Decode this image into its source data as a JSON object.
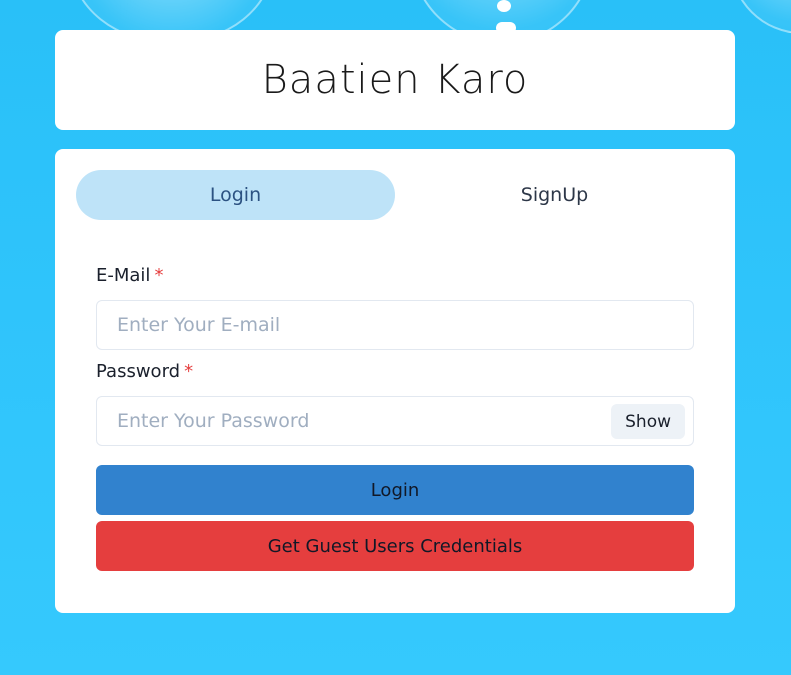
{
  "app": {
    "title": "Baatien Karo"
  },
  "tabs": [
    {
      "label": "Login",
      "active": true
    },
    {
      "label": "SignUp",
      "active": false
    }
  ],
  "form": {
    "email": {
      "label": "E-Mail",
      "required_mark": "*",
      "placeholder": "Enter Your E-mail",
      "value": ""
    },
    "password": {
      "label": "Password",
      "required_mark": "*",
      "placeholder": "Enter Your Password",
      "value": "",
      "toggle_label": "Show"
    },
    "submit_label": "Login",
    "guest_label": "Get Guest Users Credentials"
  },
  "colors": {
    "background": "#2fc4fb",
    "active_tab": "#bee3f8",
    "login_button": "#3182ce",
    "guest_button": "#e53e3e",
    "required": "#e53e3e"
  }
}
